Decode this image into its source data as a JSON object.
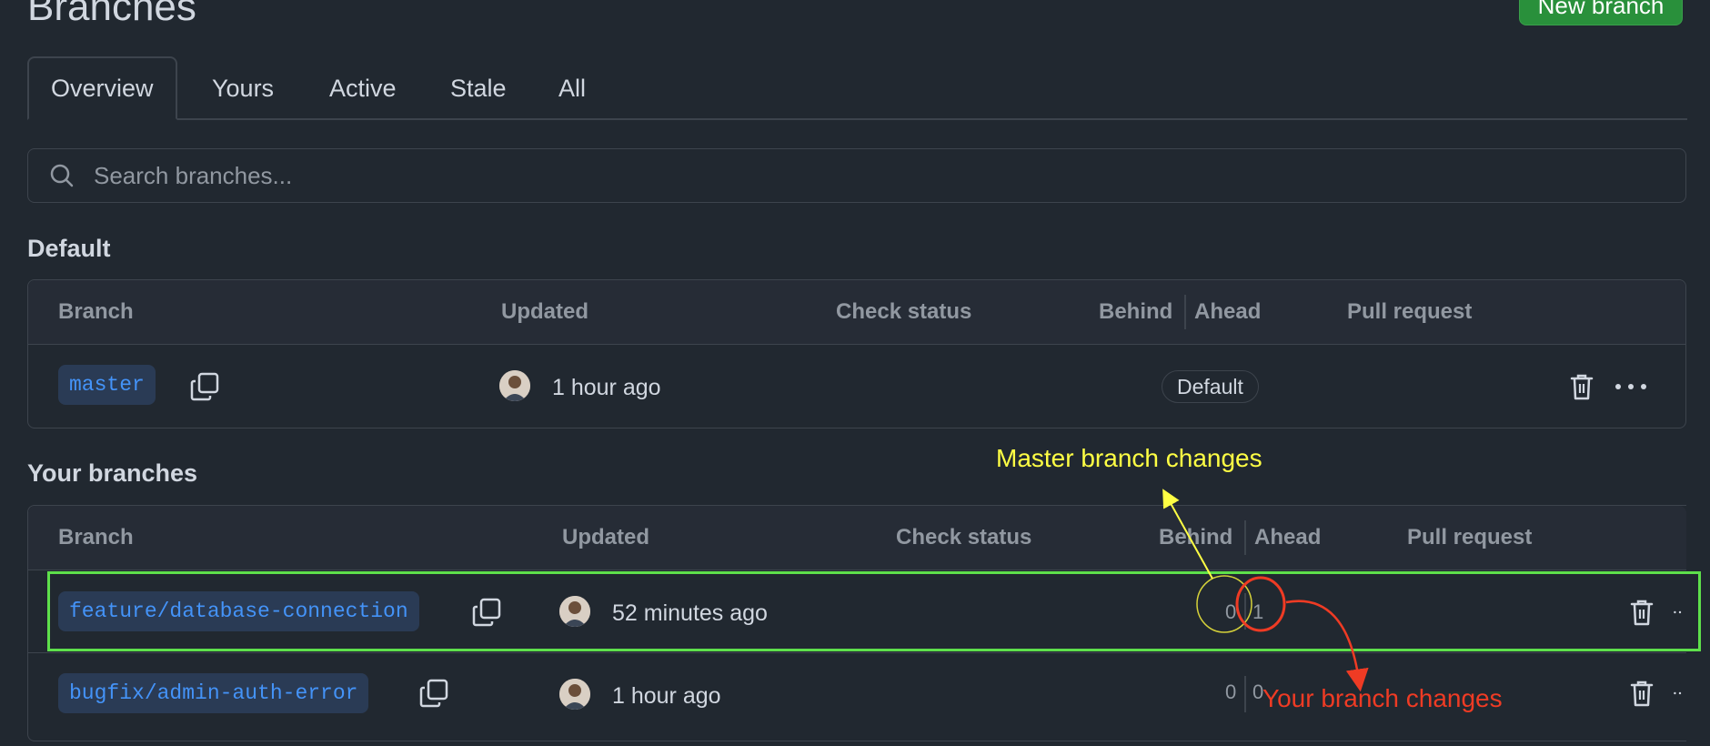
{
  "page": {
    "title": "Branches",
    "new_branch_label": "New branch"
  },
  "tabs": [
    {
      "label": "Overview",
      "selected": true
    },
    {
      "label": "Yours",
      "selected": false
    },
    {
      "label": "Active",
      "selected": false
    },
    {
      "label": "Stale",
      "selected": false
    },
    {
      "label": "All",
      "selected": false
    }
  ],
  "search": {
    "placeholder": "Search branches...",
    "value": ""
  },
  "default_section": {
    "title": "Default",
    "headers": {
      "branch": "Branch",
      "updated": "Updated",
      "check_status": "Check status",
      "behind": "Behind",
      "ahead": "Ahead",
      "pull_request": "Pull request"
    },
    "rows": [
      {
        "branch": "master",
        "updated": "1 hour ago",
        "badge": "Default"
      }
    ]
  },
  "your_section": {
    "title": "Your branches",
    "headers": {
      "branch": "Branch",
      "updated": "Updated",
      "check_status": "Check status",
      "behind": "Behind",
      "ahead": "Ahead",
      "pull_request": "Pull request"
    },
    "rows": [
      {
        "branch": "feature/database-connection",
        "updated": "52 minutes ago",
        "behind": "0",
        "ahead": "1"
      },
      {
        "branch": "bugfix/admin-auth-error",
        "updated": "1 hour ago",
        "behind": "0",
        "ahead": "0"
      }
    ]
  },
  "annotations": {
    "master_changes": "Master branch changes",
    "your_changes": "Your branch changes",
    "colors": {
      "yellow": "#ffff44",
      "red": "#ef3b24",
      "green": "#5ee04b"
    }
  },
  "icons": {
    "search": "search-icon",
    "copy": "copy-icon",
    "trash": "trash-icon",
    "more": "kebab-horizontal-icon"
  },
  "colors": {
    "background": "#212830",
    "border": "#3d444d",
    "link": "#4493f8",
    "button_green": "#29903b"
  }
}
